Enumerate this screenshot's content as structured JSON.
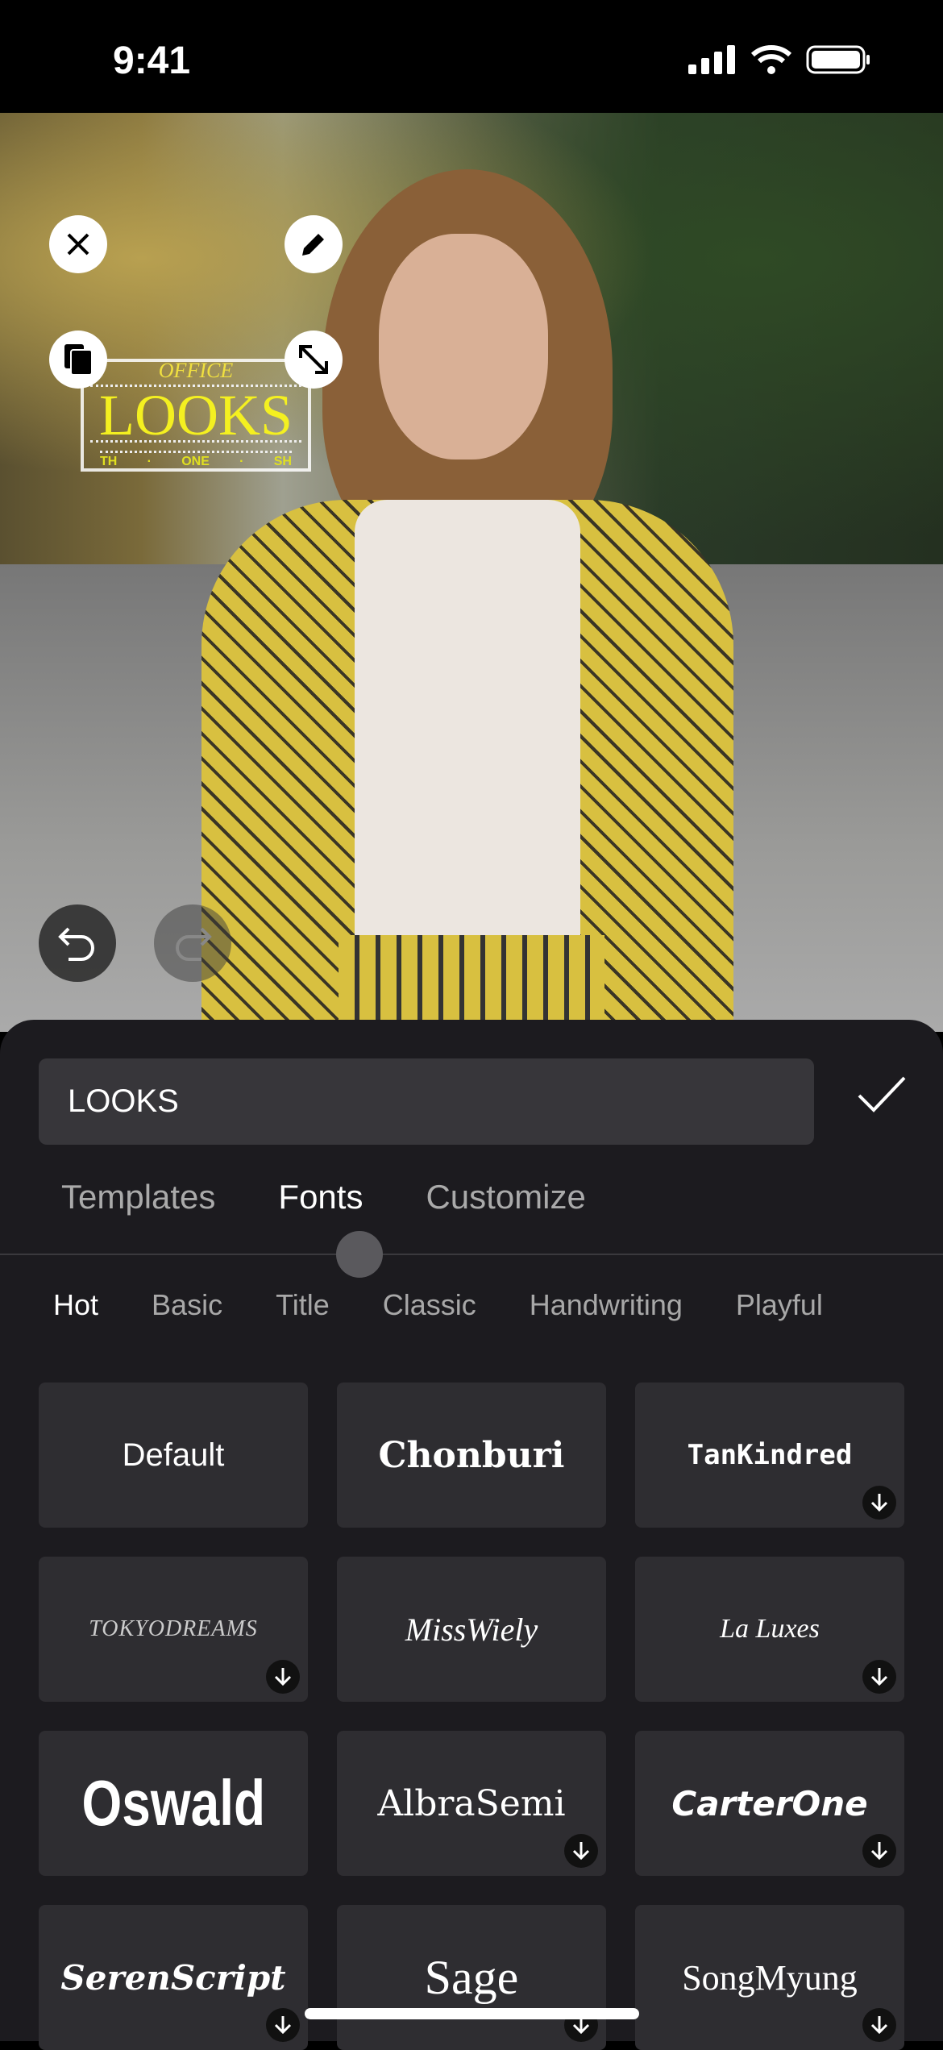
{
  "status_bar": {
    "time": "9:41",
    "icons": [
      "cellular-signal-icon",
      "wifi-icon",
      "battery-icon"
    ]
  },
  "canvas": {
    "sticker": {
      "top_text": "OFFICE",
      "main_text": "LOOKS",
      "bottom_words": [
        "TH",
        "·",
        "ONE",
        "·",
        "SH"
      ],
      "color": "#f4f020"
    },
    "handles": [
      "close-icon",
      "pencil-icon",
      "duplicate-icon",
      "resize-icon"
    ]
  },
  "editor": {
    "text_value": "LOOKS",
    "tabs": [
      {
        "label": "Templates"
      },
      {
        "label": "Fonts",
        "active": true
      },
      {
        "label": "Customize"
      }
    ],
    "categories": [
      {
        "label": "Hot",
        "active": true
      },
      {
        "label": "Basic"
      },
      {
        "label": "Title"
      },
      {
        "label": "Classic"
      },
      {
        "label": "Handwriting"
      },
      {
        "label": "Playful"
      }
    ],
    "fonts": [
      {
        "name": "Default",
        "download": false
      },
      {
        "name": "Chonburi",
        "download": false
      },
      {
        "name": "TanKindred",
        "download": true
      },
      {
        "name": "TOKYODREAMS",
        "download": true
      },
      {
        "name": "MissWiely",
        "download": false
      },
      {
        "name": "La Luxes",
        "download": true
      },
      {
        "name": "Oswald",
        "download": false
      },
      {
        "name": "AlbraSemi",
        "download": true
      },
      {
        "name": "CarterOne",
        "download": true
      },
      {
        "name": "SerenScript",
        "download": true
      },
      {
        "name": "Sage",
        "download": true
      },
      {
        "name": "SongMyung",
        "download": true
      }
    ]
  }
}
